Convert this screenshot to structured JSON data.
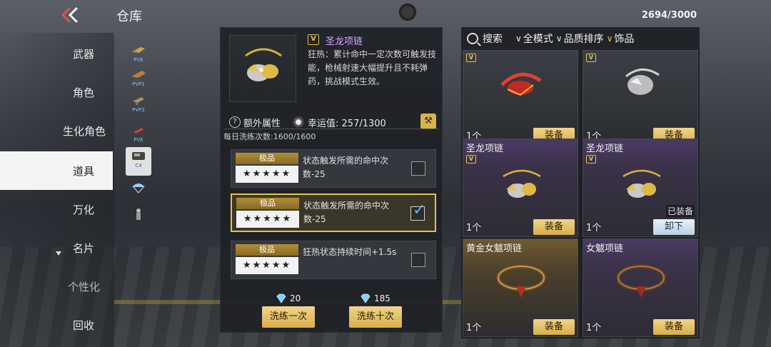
{
  "header": {
    "title": "仓库",
    "capacity": "2694/3000"
  },
  "nav": {
    "items": [
      {
        "label": "武器",
        "active": false
      },
      {
        "label": "角色",
        "active": false
      },
      {
        "label": "生化角色",
        "active": false
      },
      {
        "label": "道具",
        "active": true
      },
      {
        "label": "万化",
        "active": false
      },
      {
        "label": "名片",
        "active": false
      },
      {
        "label": "个性化",
        "active": false
      },
      {
        "label": "回收",
        "active": false
      }
    ]
  },
  "subcategories": [
    {
      "tag": "PVE",
      "icon": "gun-part-icon"
    },
    {
      "tag": "PVP1",
      "icon": "gun-part-icon"
    },
    {
      "tag": "PVP2",
      "icon": "gun-part-icon"
    },
    {
      "tag": "PVE",
      "icon": "ammo-icon"
    },
    {
      "tag": "C4",
      "icon": "c4-icon"
    },
    {
      "tag": "",
      "icon": "parachute-icon"
    },
    {
      "tag": "",
      "icon": "figure-icon"
    }
  ],
  "detail": {
    "rarity_glyph": "V",
    "name": "圣龙项链",
    "description": "狂热：累计命中一定次数可触发技能，枪械射速大幅提升且不耗弹药，挑战模式生效。",
    "extra_label": "额外属性",
    "luck_label": "幸运值: 257/1300",
    "daily_label": "每日洗练次数:1600/1600",
    "attributes": [
      {
        "grade": "极品",
        "stars": "★★★★★",
        "text": "状态触发所需的命中次数-25",
        "checked": false
      },
      {
        "grade": "极品",
        "stars": "★★★★★",
        "text": "状态触发所需的命中次数-25",
        "checked": true
      },
      {
        "grade": "极品",
        "stars": "★★★★★",
        "text": "狂热状态持续时间+1.5s",
        "checked": false
      }
    ],
    "refine_once": {
      "cost": "20",
      "label": "洗练一次"
    },
    "refine_ten": {
      "cost": "185",
      "label": "洗练十次"
    }
  },
  "filters": {
    "search": "搜索",
    "mode": "全模式",
    "sort": "品质排序",
    "category": "饰品"
  },
  "inventory": [
    {
      "name": "",
      "count": "1个",
      "action": "装备",
      "equipped": "",
      "style": "plain",
      "art": "red-dragon-necklace"
    },
    {
      "name": "",
      "count": "1个",
      "action": "装备",
      "equipped": "",
      "style": "plain",
      "art": "silver-dragon-necklace"
    },
    {
      "name": "圣龙项链",
      "count": "1个",
      "action": "装备",
      "equipped": "",
      "style": "purple",
      "art": "gold-dragon-necklace"
    },
    {
      "name": "圣龙项链",
      "count": "1个",
      "action": "卸下",
      "equipped": "已装备",
      "style": "purple",
      "art": "gold-dragon-necklace"
    },
    {
      "name": "黄金女魃项链",
      "count": "1个",
      "action": "装备",
      "equipped": "",
      "style": "gold",
      "art": "ring-necklace"
    },
    {
      "name": "女魃项链",
      "count": "1个",
      "action": "装备",
      "equipped": "",
      "style": "purple",
      "art": "ring-necklace"
    }
  ],
  "colors": {
    "accent_gold": "#d8ad4a",
    "purple_name": "#d5a5ff",
    "check_blue": "#5fb3ff"
  }
}
